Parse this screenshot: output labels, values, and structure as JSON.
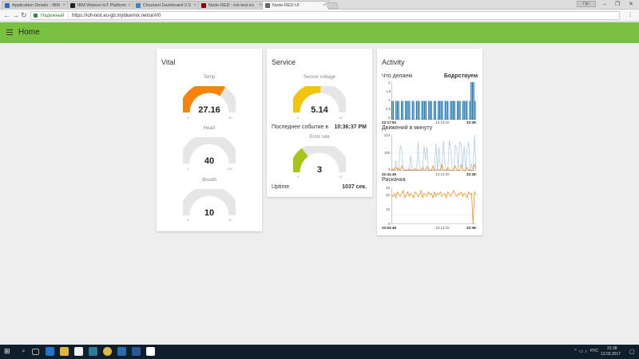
{
  "browser": {
    "tabs": [
      {
        "title": "Application Details - IBM"
      },
      {
        "title": "IBM Watson IoT Platform"
      },
      {
        "title": "Cloudant Dashboard 2.0"
      },
      {
        "title": "Node-RED : ioh-test.eu"
      },
      {
        "title": "Node-RED UI"
      }
    ],
    "user_label": "Грс",
    "security_label": "Надежный",
    "url": "https://ioh-test.eu-gb.mybluemix.net/ui/#/0"
  },
  "app": {
    "title": "Home",
    "accent": "#7ac142"
  },
  "vital": {
    "title": "Vital",
    "temp": {
      "label": "Temp",
      "value": "27.16",
      "min": "0",
      "max": "40",
      "fraction": 0.68,
      "color": "#f5840c"
    },
    "heart": {
      "label": "Heart",
      "value": "40",
      "min": "0",
      "max": "120",
      "fraction": 0.0,
      "color": "#f5840c"
    },
    "breath": {
      "label": "Breath",
      "value": "10",
      "min": "0",
      "max": "40",
      "fraction": 0.0,
      "color": "#f5840c"
    }
  },
  "service": {
    "title": "Service",
    "voltage": {
      "label": "Sensor voltage",
      "value": "5.14",
      "min": "0",
      "max": "10",
      "fraction": 0.514,
      "color": "#f2c40c"
    },
    "last_event_label": "Последнее событие в",
    "last_event_value": "10:36:37 PM",
    "error": {
      "label": "Error rate",
      "value": "3",
      "min": "0",
      "max": "10",
      "fraction": 0.3,
      "color": "#a6c41a"
    },
    "uptime_label": "Uptime",
    "uptime_value": "1037 сек."
  },
  "activity": {
    "title": "Activity",
    "status_label": "Что делаем",
    "status_value": "Бодрствуем",
    "chart1": {
      "yticks": [
        "2",
        "1.5",
        "1",
        "0.5",
        "0"
      ],
      "xticks": [
        "22:17:52",
        "13:13:20",
        "22:36:"
      ]
    },
    "chart2": {
      "title": "Движений в минуту",
      "yticks": [
        "212",
        "100",
        "0"
      ],
      "xticks": [
        "22:41:46",
        "13:13:20",
        "22:36:"
      ]
    },
    "chart3": {
      "title": "Раскачка",
      "yticks": [
        "25",
        "20",
        "10",
        "0"
      ],
      "xticks": [
        "22:53:46",
        "13:13:20",
        "22:36:"
      ]
    }
  },
  "chart_data": [
    {
      "type": "bar",
      "title": "",
      "ylim": [
        0,
        2
      ],
      "series": [
        {
          "values": [
            1,
            1,
            0,
            1,
            1,
            1,
            0,
            1,
            1,
            0,
            1,
            1,
            1,
            1,
            0,
            1,
            1,
            0,
            1,
            1,
            1,
            0,
            1,
            1,
            1,
            1,
            0,
            1,
            1,
            1,
            0,
            1,
            1,
            0,
            1,
            1,
            1,
            1,
            0,
            1,
            1,
            1,
            0,
            1,
            1,
            1,
            1,
            0,
            1,
            1,
            1,
            0,
            1,
            1,
            1,
            1,
            0,
            1,
            2,
            2,
            2,
            1
          ]
        }
      ],
      "color": "#1f77b4"
    },
    {
      "type": "line",
      "title": "Движений в минуту",
      "ylim": [
        0,
        212
      ],
      "series": [
        {
          "values": [
            2,
            5,
            3,
            60,
            8,
            4,
            150,
            120,
            10,
            4,
            2,
            6,
            3,
            90,
            5,
            2,
            3,
            4,
            170,
            10,
            3,
            2,
            150,
            60,
            140,
            4,
            3,
            2,
            8,
            3,
            160,
            5,
            140,
            10,
            3,
            180,
            40,
            4,
            2,
            180,
            110,
            5,
            3,
            150,
            140,
            3,
            170,
            160,
            10,
            150,
            3,
            120,
            170,
            4,
            40,
            2,
            212,
            3
          ],
          "color": "#a8c7e6"
        },
        {
          "values": [
            2,
            10,
            3,
            20,
            4,
            15,
            2,
            30,
            8,
            2,
            5,
            3,
            10,
            2,
            4,
            3,
            15,
            2,
            6,
            3,
            4,
            20,
            3,
            2,
            25,
            3,
            5,
            2,
            30,
            3,
            4,
            10,
            3,
            2,
            40,
            5,
            3,
            2,
            20,
            3,
            5,
            2,
            4,
            30,
            3,
            5,
            2,
            35,
            4,
            3,
            2,
            20,
            3,
            5,
            2,
            4,
            40,
            6
          ],
          "color": "#f5840c"
        }
      ]
    },
    {
      "type": "line",
      "title": "Раскачка",
      "ylim": [
        0,
        25
      ],
      "series": [
        {
          "values": [
            20,
            19,
            21,
            18,
            22,
            20,
            19,
            21,
            23,
            18,
            20,
            22,
            19,
            21,
            20,
            18,
            22,
            21,
            19,
            20,
            23,
            18,
            21,
            20,
            19,
            22,
            20,
            21,
            18,
            22,
            19,
            21,
            20,
            22,
            19,
            20,
            21,
            18,
            22,
            20,
            19,
            21,
            23,
            20,
            19,
            21,
            20,
            22,
            19,
            21,
            20,
            18,
            22,
            20,
            21,
            0,
            22,
            20
          ],
          "color": "#f5840c"
        }
      ]
    }
  ],
  "taskbar": {
    "lang": "РУС",
    "time": "22:38",
    "date": "13.03.2017"
  }
}
